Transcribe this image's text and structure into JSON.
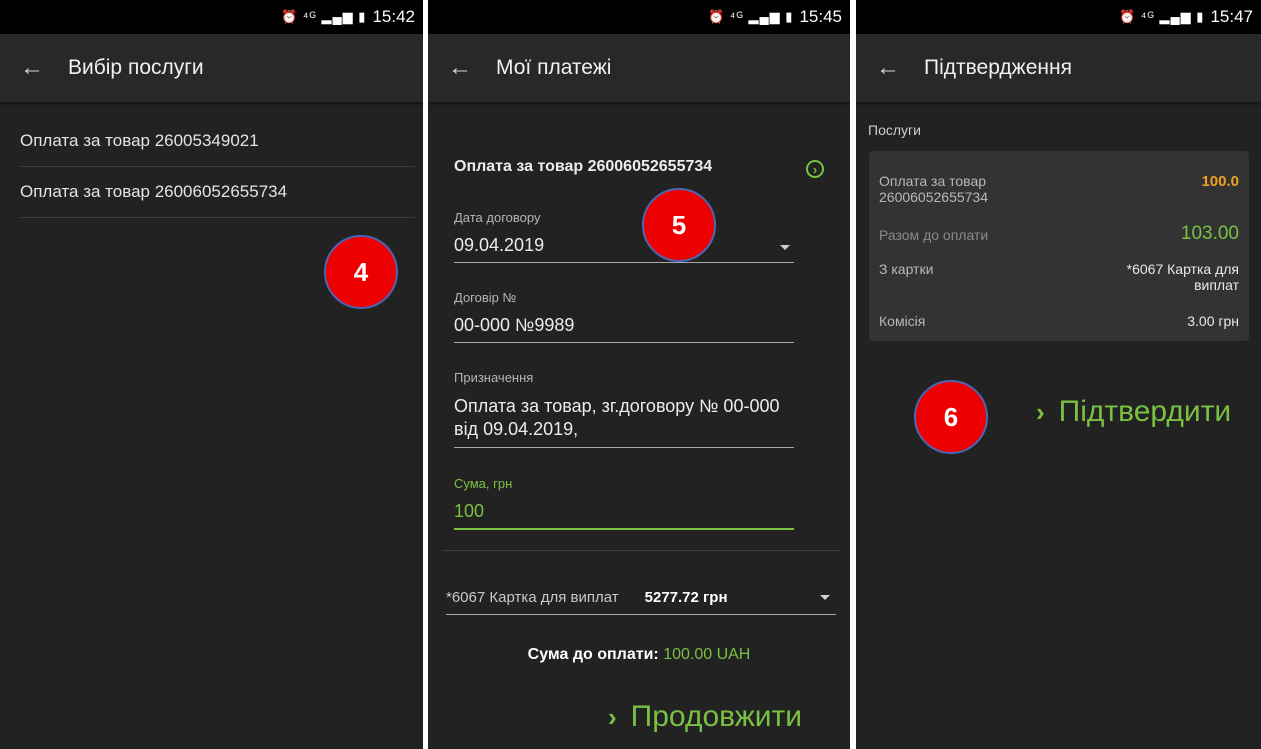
{
  "status_bar": {
    "icons": "⏰ ⁴ᴳ ▂▄▆ ▮",
    "screen1_time": "15:42",
    "screen2_time": "15:45",
    "screen3_time": "15:47"
  },
  "screen1": {
    "title": "Вибір послуги",
    "services": [
      "Оплата за товар 26005349021",
      "Оплата за товар 26006052655734"
    ],
    "badge": "4"
  },
  "screen2": {
    "title": "Мої платежі",
    "payment_title": "Оплата за товар 26006052655734",
    "badge": "5",
    "contract_date_label": "Дата договору",
    "contract_date": "09.04.2019",
    "contract_no_label": "Договір №",
    "contract_no": "00-000 №9989",
    "purpose_label": "Призначення",
    "purpose": "Оплата за товар, зг.договору № 00-000 від 09.04.2019,",
    "amount_label": "Сума, грн",
    "amount": "100",
    "card_name": "*6067 Картка для виплат",
    "card_balance": "5277.72 грн",
    "total_label": "Сума до оплати:",
    "total_value": "100.00 UAH",
    "continue_label": "Продовжити"
  },
  "screen3": {
    "title": "Підтвердження",
    "section_label": "Послуги",
    "service_name": "Оплата за товар 26006052655734",
    "service_amount": "100.0",
    "total_label": "Разом до оплати",
    "total_value": "103.00",
    "card_label": "З картки",
    "card_value": "*6067 Картка для виплат",
    "fee_label": "Комісія",
    "fee_value": "3.00 грн",
    "confirm_label": "Підтвердити",
    "badge": "6"
  },
  "colors": {
    "accent_green": "#7ac142",
    "amount_orange": "#f0a020",
    "badge_red": "#ee0000",
    "background": "#222222"
  }
}
